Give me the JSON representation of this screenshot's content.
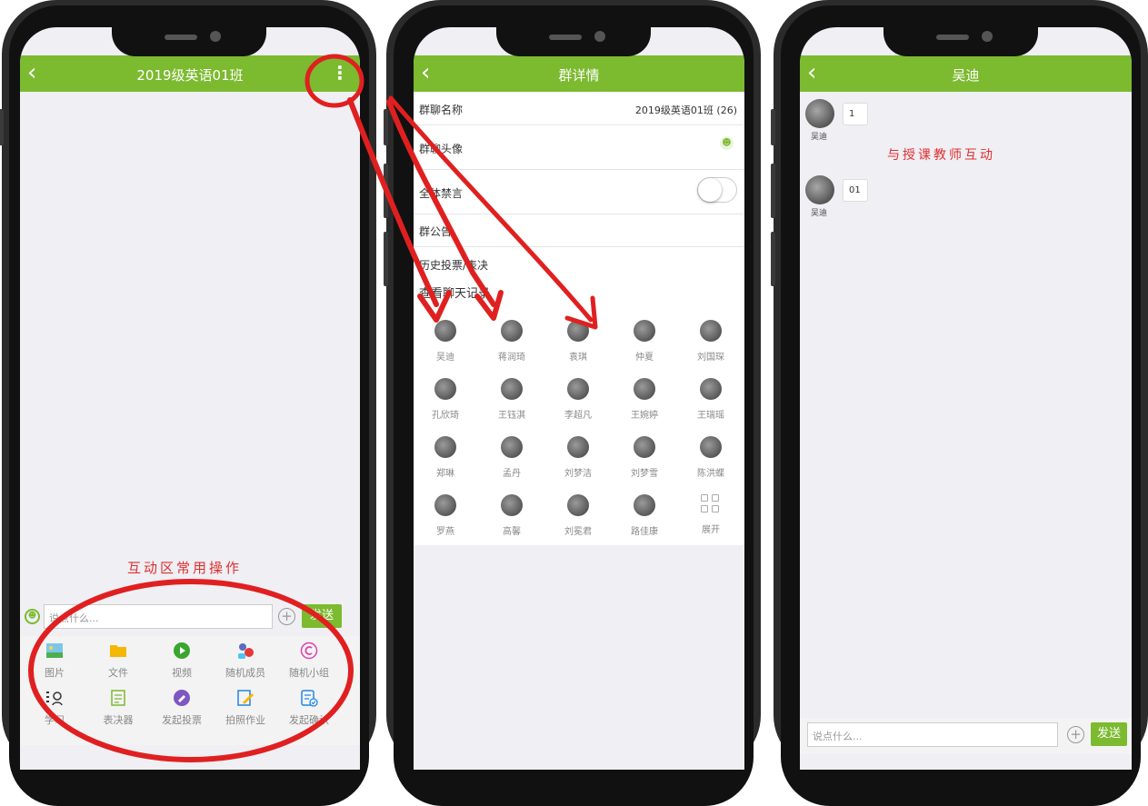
{
  "phone1": {
    "title": "2019级英语01班",
    "back_icon": "chevron-left-icon",
    "more_icon": "more-vertical-icon",
    "annotation": "互动区常用操作",
    "input_placeholder": "说点什么...",
    "send_label": "发送",
    "tools": [
      {
        "label": "图片",
        "icon": "image-icon",
        "color": "#4caf50"
      },
      {
        "label": "文件",
        "icon": "folder-icon",
        "color": "#f5b800"
      },
      {
        "label": "视频",
        "icon": "video-icon",
        "color": "#3aa52f"
      },
      {
        "label": "随机成员",
        "icon": "random-member-icon",
        "color": "#e53935"
      },
      {
        "label": "随机小组",
        "icon": "random-group-icon",
        "color": "#e040b0"
      },
      {
        "label": "学习",
        "icon": "study-icon",
        "color": "#333333"
      },
      {
        "label": "表决器",
        "icon": "voter-icon",
        "color": "#7cba2f"
      },
      {
        "label": "发起投票",
        "icon": "vote-icon",
        "color": "#7e57c2"
      },
      {
        "label": "拍照作业",
        "icon": "photo-homework-icon",
        "color": "#1e88e5"
      },
      {
        "label": "发起确认",
        "icon": "confirm-icon",
        "color": "#1e88e5"
      }
    ]
  },
  "phone2": {
    "title": "群详情",
    "rows": [
      {
        "label": "群聊名称",
        "value": "2019级英语01班 (26)"
      },
      {
        "label": "群聊头像",
        "value": ""
      },
      {
        "label": "全体禁言",
        "value": ""
      },
      {
        "label": "群公告",
        "value": ""
      },
      {
        "label": "历史投票/表决",
        "value": ""
      },
      {
        "label": "查看聊天记录",
        "value": ""
      }
    ],
    "members": [
      "吴迪",
      "蒋润琦",
      "袁琪",
      "仲夏",
      "刘国琛",
      "孔欣琦",
      "王钰淇",
      "李超凡",
      "王婉婷",
      "王瑞瑶",
      "郑琳",
      "孟丹",
      "刘梦洁",
      "刘梦雪",
      "陈洪蝶",
      "罗燕",
      "高馨",
      "刘冕君",
      "路佳康"
    ],
    "expand_label": "展开"
  },
  "phone3": {
    "title": "吴迪",
    "messages": [
      {
        "sender": "吴迪",
        "text": "1"
      },
      {
        "sender": "吴迪",
        "text": "01"
      }
    ],
    "annotation": "与授课教师互动",
    "input_placeholder": "说点什么...",
    "send_label": "发送"
  },
  "colors": {
    "accent": "#7cba2f",
    "annotation": "#e03030"
  }
}
